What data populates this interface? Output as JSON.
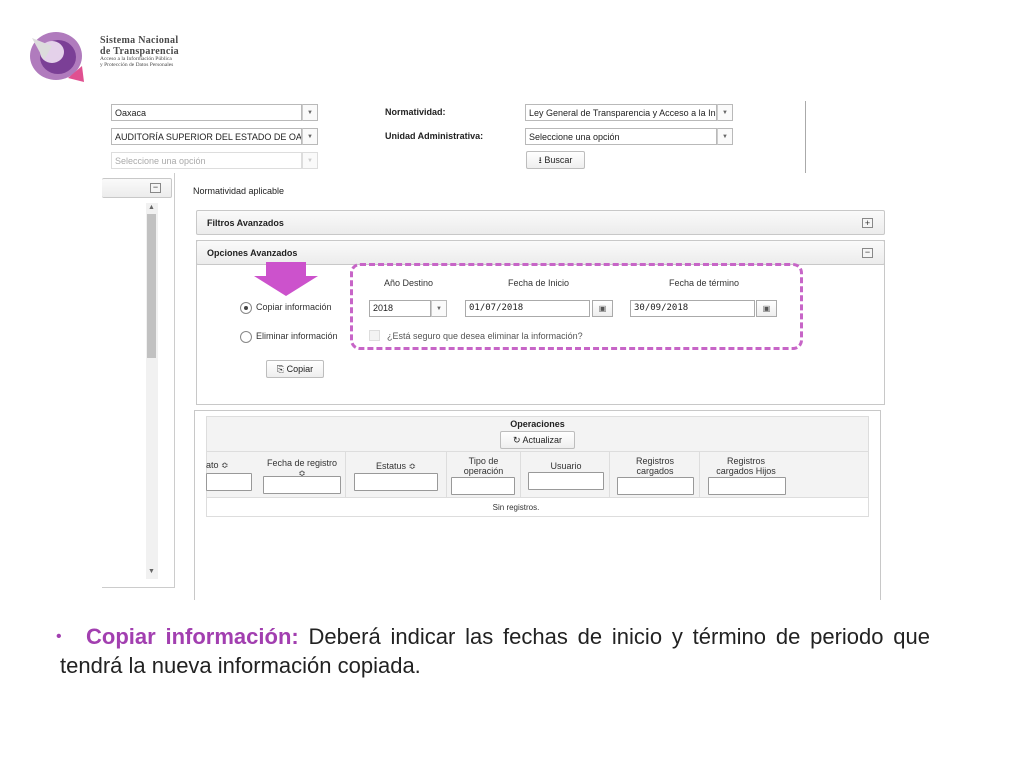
{
  "logo": {
    "line1": "Sistema Nacional",
    "line2": "de Transparencia",
    "line3": "Acceso a la Información Pública",
    "line4": "y Protección de Datos Personales"
  },
  "filters": {
    "state_value": "Oaxaca",
    "institution_value": "AUDITORÍA SUPERIOR DEL ESTADO DE OA",
    "third_placeholder": "Seleccione una opción",
    "normatividad_label": "Normatividad:",
    "normatividad_value": "Ley General de Transparencia y Acceso a la In",
    "unidad_label": "Unidad Administrativa:",
    "unidad_value": "Seleccione una opción",
    "search_label": "Buscar"
  },
  "main": {
    "normatividad_aplicable": "Normatividad aplicable",
    "filtros_avanzados": "Filtros Avanzados",
    "opciones_avanzados": "Opciones Avanzados",
    "copy_option": "Copiar información",
    "delete_option": "Eliminar información",
    "copy_button": "Copiar",
    "year_label": "Año Destino",
    "year_value": "2018",
    "start_label": "Fecha de Inicio",
    "start_value": "01/07/2018",
    "end_label": "Fecha de término",
    "end_value": "30/09/2018",
    "confirm_delete": "¿Está seguro que desea eliminar la información?"
  },
  "operations": {
    "title": "Operaciones",
    "refresh_label": "Actualizar",
    "columns": [
      "ato ≎",
      "Fecha de registro ≎",
      "Estatus ≎",
      "Tipo de operación",
      "Usuario",
      "Registros cargados",
      "Registros cargados Hijos"
    ],
    "empty_message": "Sin registros."
  },
  "caption": {
    "bold": "Copiar información:",
    "text": " Deberá indicar las fechas de inicio y término de periodo que tendrá la nueva información copiada."
  },
  "colors": {
    "accent_purple": "#a23fb0",
    "arrow_magenta": "#cc52cc",
    "dashed_border": "#c765c7"
  }
}
